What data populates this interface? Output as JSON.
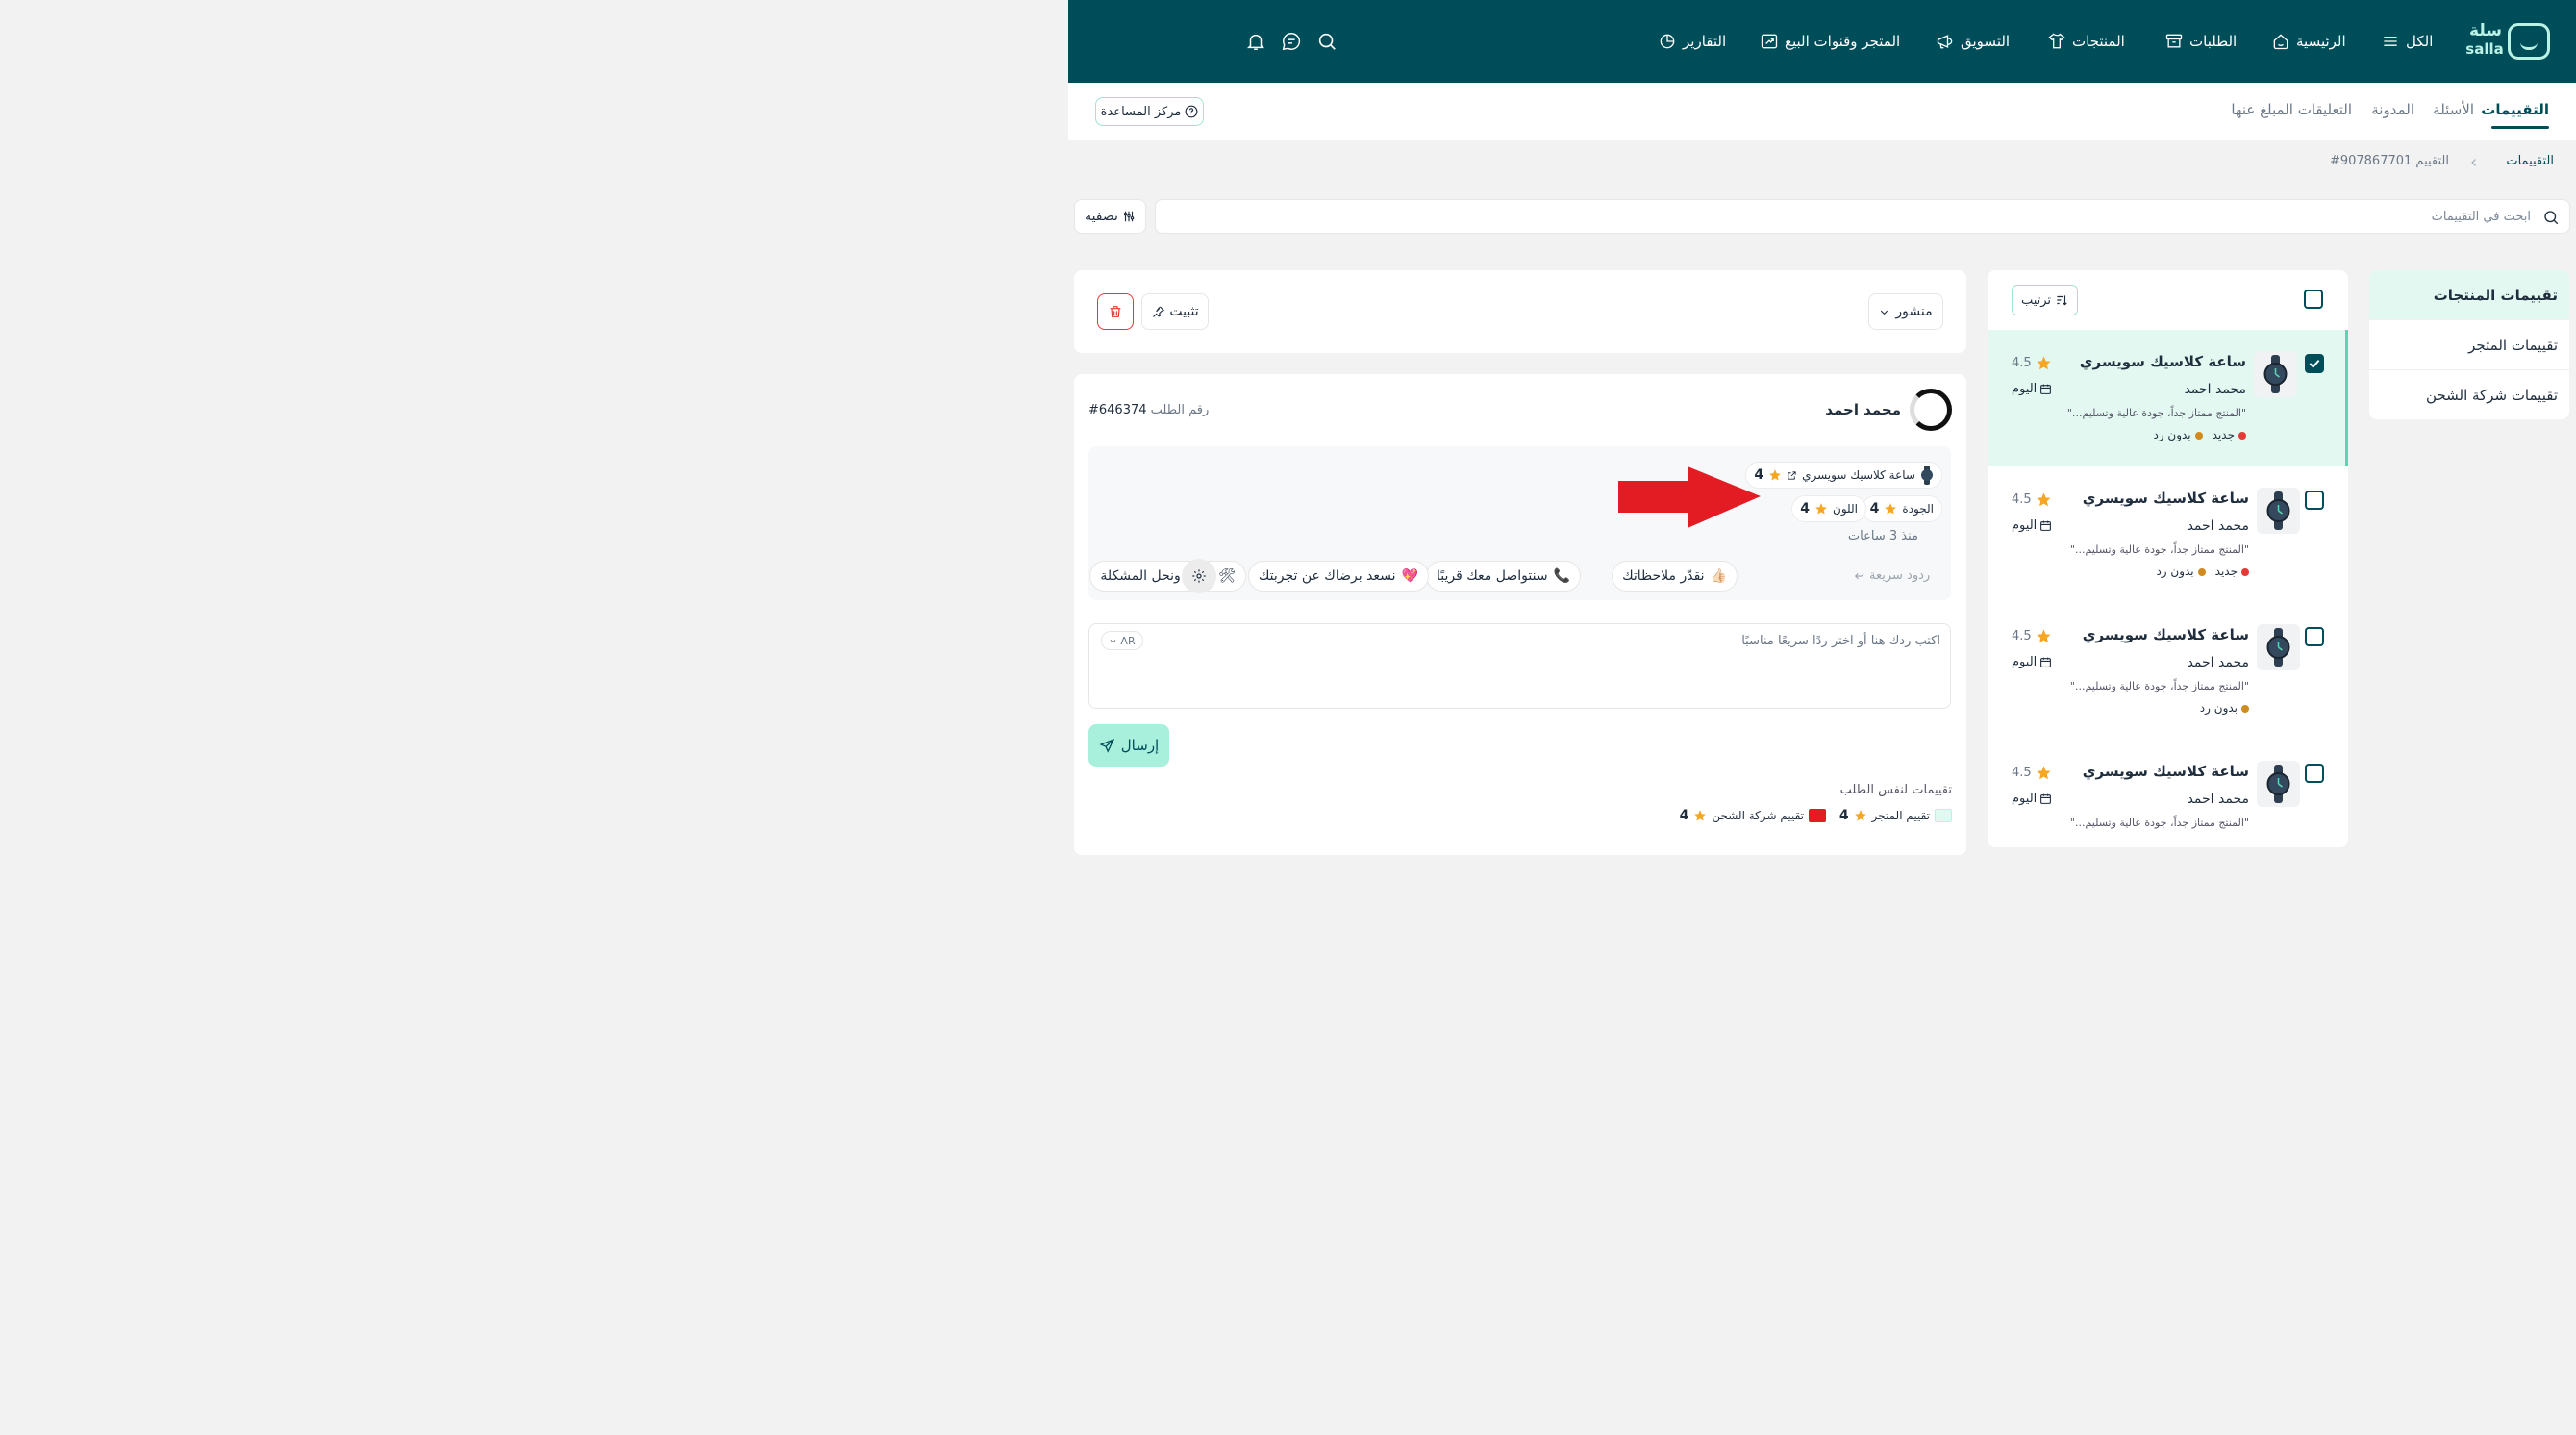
{
  "brand": {
    "name_ar": "سلة",
    "name_en": "salla"
  },
  "topnav": [
    {
      "label": "الكل",
      "icon": "menu-icon"
    },
    {
      "label": "الرئيسية",
      "icon": "home-icon"
    },
    {
      "label": "الطلبات",
      "icon": "box-icon"
    },
    {
      "label": "المنتجات",
      "icon": "shirt-icon"
    },
    {
      "label": "التسويق",
      "icon": "megaphone-icon"
    },
    {
      "label": "المتجر وقنوات البيع",
      "icon": "store-icon"
    },
    {
      "label": "التقارير",
      "icon": "pie-chart-icon"
    }
  ],
  "subtabs": [
    {
      "label": "التقييمات",
      "active": true
    },
    {
      "label": "الأسئلة"
    },
    {
      "label": "المدونة"
    },
    {
      "label": "التعليقات المبلغ عنها"
    }
  ],
  "help_center": "مركز المساعدة",
  "breadcrumb": {
    "root": "التقييمات",
    "current": "التقييم 907867701#"
  },
  "search": {
    "placeholder": "ابحث في التقييمات"
  },
  "filter_label": "تصفية",
  "categories": [
    {
      "label": "تقييمات المنتجات",
      "active": true
    },
    {
      "label": "تقييمات المتجر"
    },
    {
      "label": "تقييمات شركة الشحن"
    }
  ],
  "sort_label": "ترتيب",
  "reviews": [
    {
      "title": "ساعة كلاسيك سويسري",
      "author": "محمد احمد",
      "excerpt": "\"المنتج ممتاز جداً، جودة عالية وتسليم...\"",
      "badges": [
        {
          "label": "جديد",
          "color": "#e53935"
        },
        {
          "label": "بدون رد",
          "color": "#d08a1e"
        }
      ],
      "rating": "4.5",
      "date": "اليوم",
      "checked": true,
      "selected": true
    },
    {
      "title": "ساعة كلاسيك سويسري",
      "author": "محمد احمد",
      "excerpt": "\"المنتج ممتاز جداً، جودة عالية وتسليم...\"",
      "badges": [
        {
          "label": "جديد",
          "color": "#e53935"
        },
        {
          "label": "بدون رد",
          "color": "#d08a1e"
        }
      ],
      "rating": "4.5",
      "date": "اليوم",
      "checked": false
    },
    {
      "title": "ساعة كلاسيك سويسري",
      "author": "محمد احمد",
      "excerpt": "\"المنتج ممتاز جداً، جودة عالية وتسليم...\"",
      "badges": [
        {
          "label": "بدون رد",
          "color": "#d08a1e"
        }
      ],
      "rating": "4.5",
      "date": "اليوم",
      "checked": false
    },
    {
      "title": "ساعة كلاسيك سويسري",
      "author": "محمد احمد",
      "excerpt": "\"المنتج ممتاز جداً، جودة عالية وتسليم...\"",
      "badges": [],
      "rating": "4.5",
      "date": "اليوم",
      "checked": false
    }
  ],
  "actions": {
    "status": "منشور",
    "pin": "تثبيت"
  },
  "detail": {
    "reviewer": "محمد احمد",
    "order_label": "رقم الطلب",
    "order_no": "#646374",
    "product": {
      "name": "ساعة كلاسيك سويسري",
      "rating": "4"
    },
    "aspects": [
      {
        "label": "الجودة",
        "rating": "4"
      },
      {
        "label": "اللون",
        "rating": "4"
      }
    ],
    "since": "منذ 3 ساعات",
    "quick_replies_label": "ردود سريعة",
    "quick_replies": [
      {
        "label": "نقدّر ملاحظاتك",
        "emoji": "👍🏻"
      },
      {
        "label": "سنتواصل معك قريبًا",
        "emoji": "📞"
      },
      {
        "label": "نسعد برضاك عن تجربتك",
        "emoji": "💖"
      },
      {
        "label": "نعتذر ونحل المشكلة",
        "emoji": "🛠"
      }
    ],
    "reply_placeholder": "اكتب ردك هنا أو اختر ردًا سريعًا مناسبًا",
    "lang": "AR",
    "send": "إرسال",
    "same_order_label": "تقييمات لنفس الطلب",
    "same_order": [
      {
        "label": "تقييم المتجر",
        "rating": "4"
      },
      {
        "label": "تقييم شركة الشحن",
        "rating": "4"
      }
    ]
  },
  "colors": {
    "primary": "#004d5a",
    "accent": "#baf3e6",
    "selected_bg": "#e3f8f1",
    "star": "#f5a623",
    "danger": "#e53935",
    "arrow": "#e31b23"
  }
}
